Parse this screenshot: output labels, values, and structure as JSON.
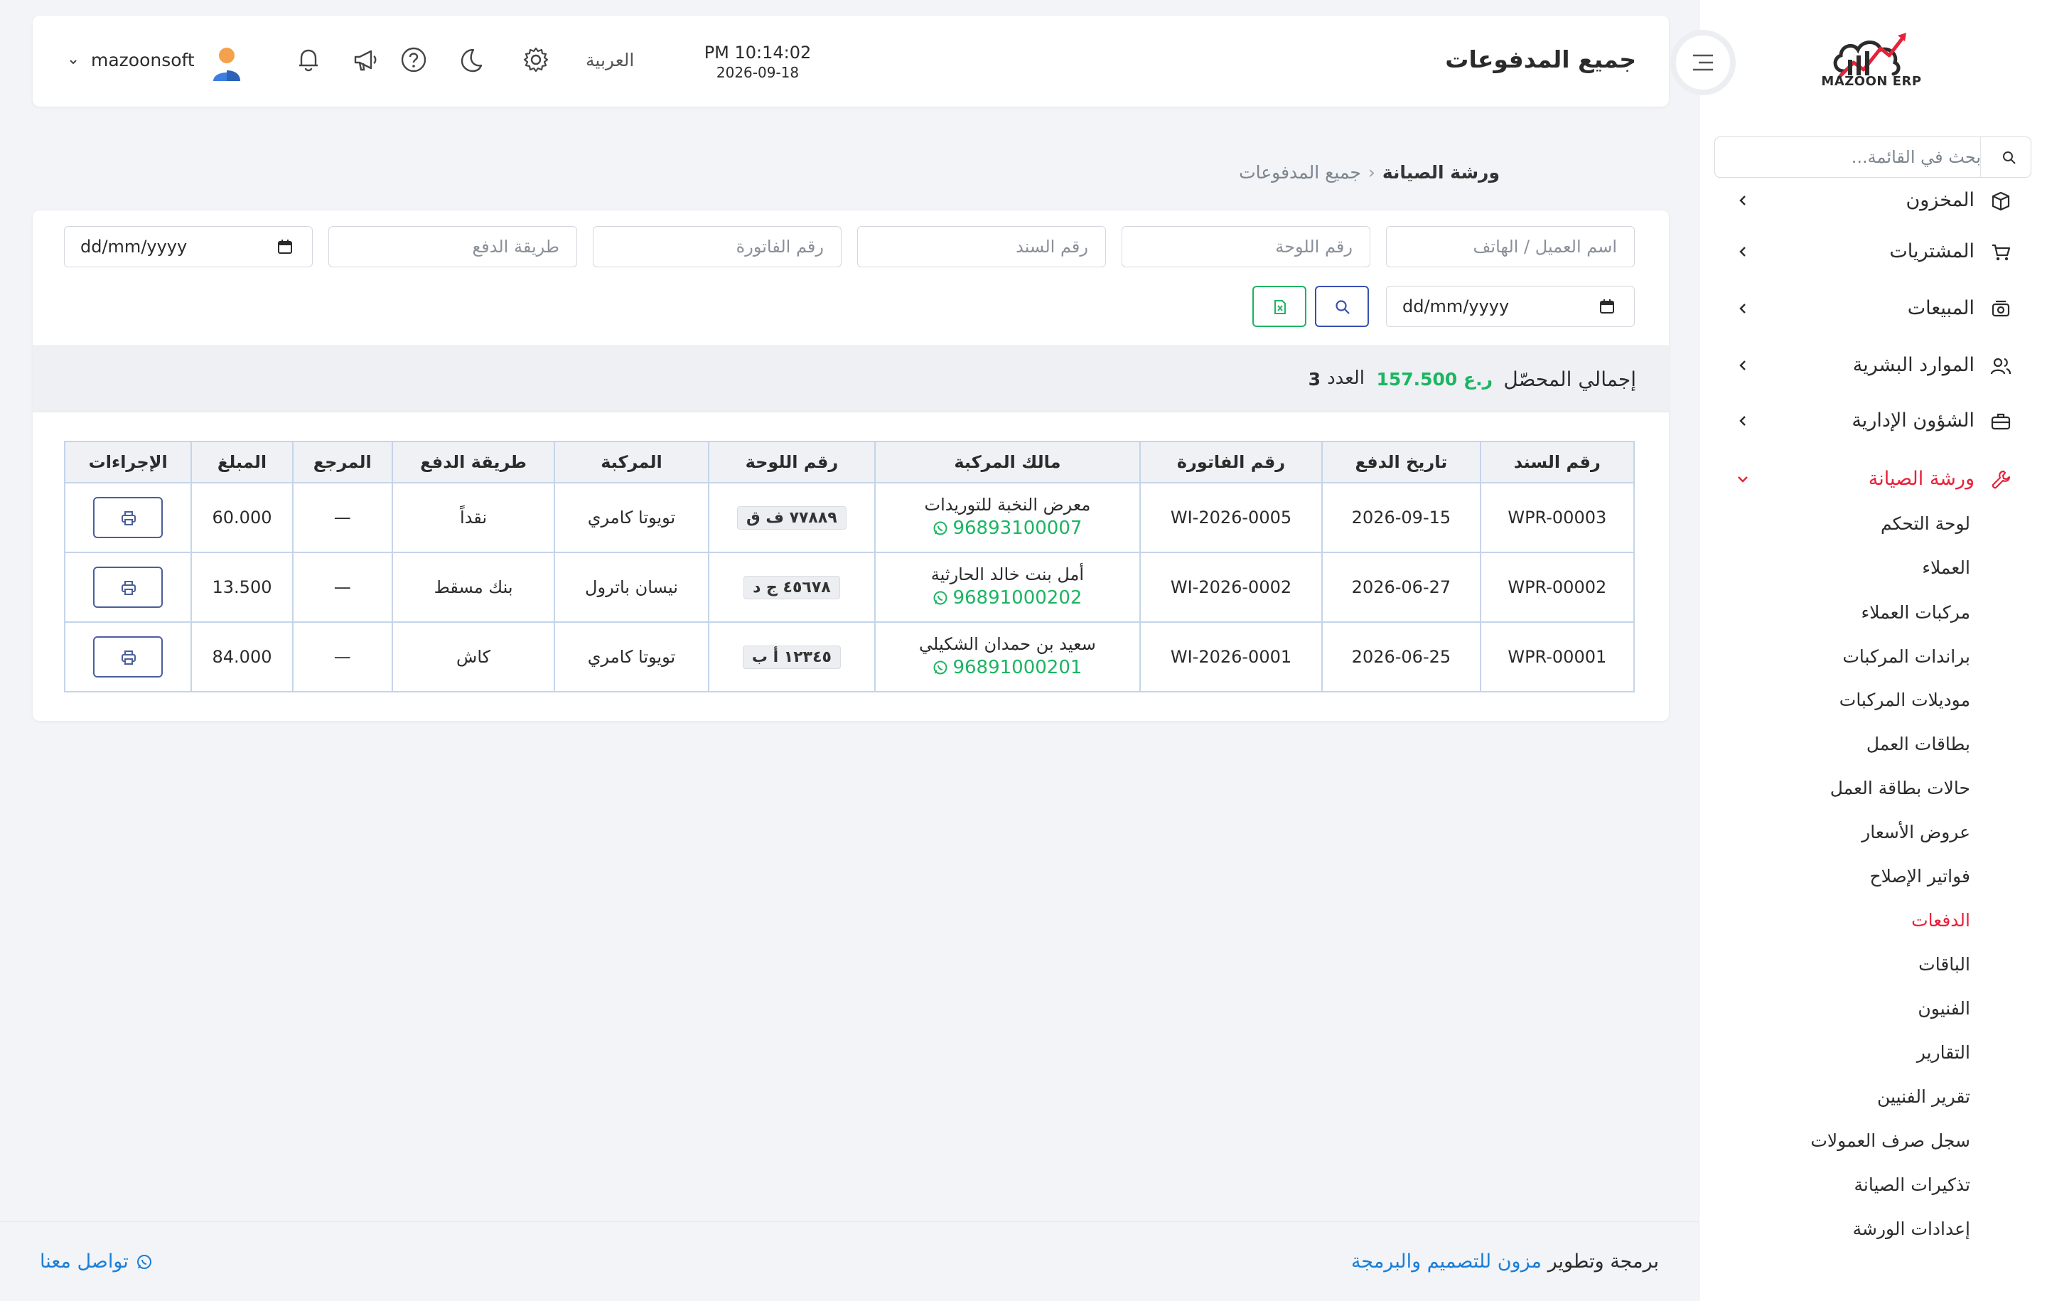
{
  "app": {
    "logo_text": "MAZOON ERP",
    "logo_arabic": "مزون",
    "brand_colors": {
      "red": "#e8213a",
      "blue": "#1a7ed8",
      "green": "#1cb562"
    }
  },
  "sidebar": {
    "search_placeholder": "بحث في القائمة...",
    "items": [
      {
        "label": "المخزون",
        "icon": "box-icon"
      },
      {
        "label": "المشتريات",
        "icon": "cart-icon"
      },
      {
        "label": "المبيعات",
        "icon": "cash-register-icon"
      },
      {
        "label": "الموارد البشرية",
        "icon": "users-icon"
      },
      {
        "label": "الشؤون الإدارية",
        "icon": "briefcase-icon"
      },
      {
        "label": "ورشة الصيانة",
        "icon": "wrench-icon"
      }
    ],
    "sub_items": [
      "لوحة التحكم",
      "العملاء",
      "مركبات العملاء",
      "براندات المركبات",
      "موديلات المركبات",
      "بطاقات العمل",
      "حالات بطاقة العمل",
      "عروض الأسعار",
      "فواتير الإصلاح",
      "الدفعات",
      "الباقات",
      "الفنيون",
      "التقارير",
      "تقرير الفنيين",
      "سجل صرف العمولات",
      "تذكيرات الصيانة",
      "إعدادات الورشة"
    ]
  },
  "topbar": {
    "title": "جميع المدفوعات",
    "time": "PM 10:14:02",
    "date": "2026-09-18",
    "language": "العربية",
    "username": "mazoonsoft"
  },
  "breadcrumb": {
    "parent": "ورشة الصيانة",
    "current": "جميع المدفوعات"
  },
  "filters": {
    "customer_placeholder": "اسم العميل / الهاتف",
    "plate_placeholder": "رقم اللوحة",
    "voucher_placeholder": "رقم السند",
    "invoice_placeholder": "رقم الفاتورة",
    "method_placeholder": "طريقة الدفع",
    "date_from": "dd/mm/yyyy",
    "date_to": "dd/mm/yyyy"
  },
  "summary": {
    "total_label": "إجمالي المحصّل",
    "total_value": "157.500 ر.ع",
    "count_label": "العدد",
    "count_value": "3"
  },
  "table": {
    "headers": [
      "رقم السند",
      "تاريخ الدفع",
      "رقم الفاتورة",
      "مالك المركبة",
      "رقم اللوحة",
      "المركبة",
      "طريقة الدفع",
      "المرجع",
      "المبلغ",
      "الإجراءات"
    ],
    "rows": [
      {
        "voucher": "WPR-00003",
        "date": "2026-09-15",
        "invoice": "WI-2026-0005",
        "owner": "معرض النخبة للتوريدات",
        "phone": "96893100007",
        "plate": "٧٧٨٨٩ ف ق",
        "vehicle": "تويوتا كامري",
        "method": "نقداً",
        "ref": "—",
        "amount": "60.000"
      },
      {
        "voucher": "WPR-00002",
        "date": "2026-06-27",
        "invoice": "WI-2026-0002",
        "owner": "أمل بنت خالد الحارثية",
        "phone": "96891000202",
        "plate": "٤٥٦٧٨ ج د",
        "vehicle": "نيسان باترول",
        "method": "بنك مسقط",
        "ref": "—",
        "amount": "13.500"
      },
      {
        "voucher": "WPR-00001",
        "date": "2026-06-25",
        "invoice": "WI-2026-0001",
        "owner": "سعيد بن حمدان الشكيلي",
        "phone": "96891000201",
        "plate": "١٢٣٤٥ أ ب",
        "vehicle": "تويوتا كامري",
        "method": "كاش",
        "ref": "—",
        "amount": "84.000"
      }
    ]
  },
  "footer": {
    "credit_prefix": "برمجة وتطوير",
    "credit_link": "مزون للتصميم والبرمجة",
    "contact": "تواصل معنا"
  }
}
